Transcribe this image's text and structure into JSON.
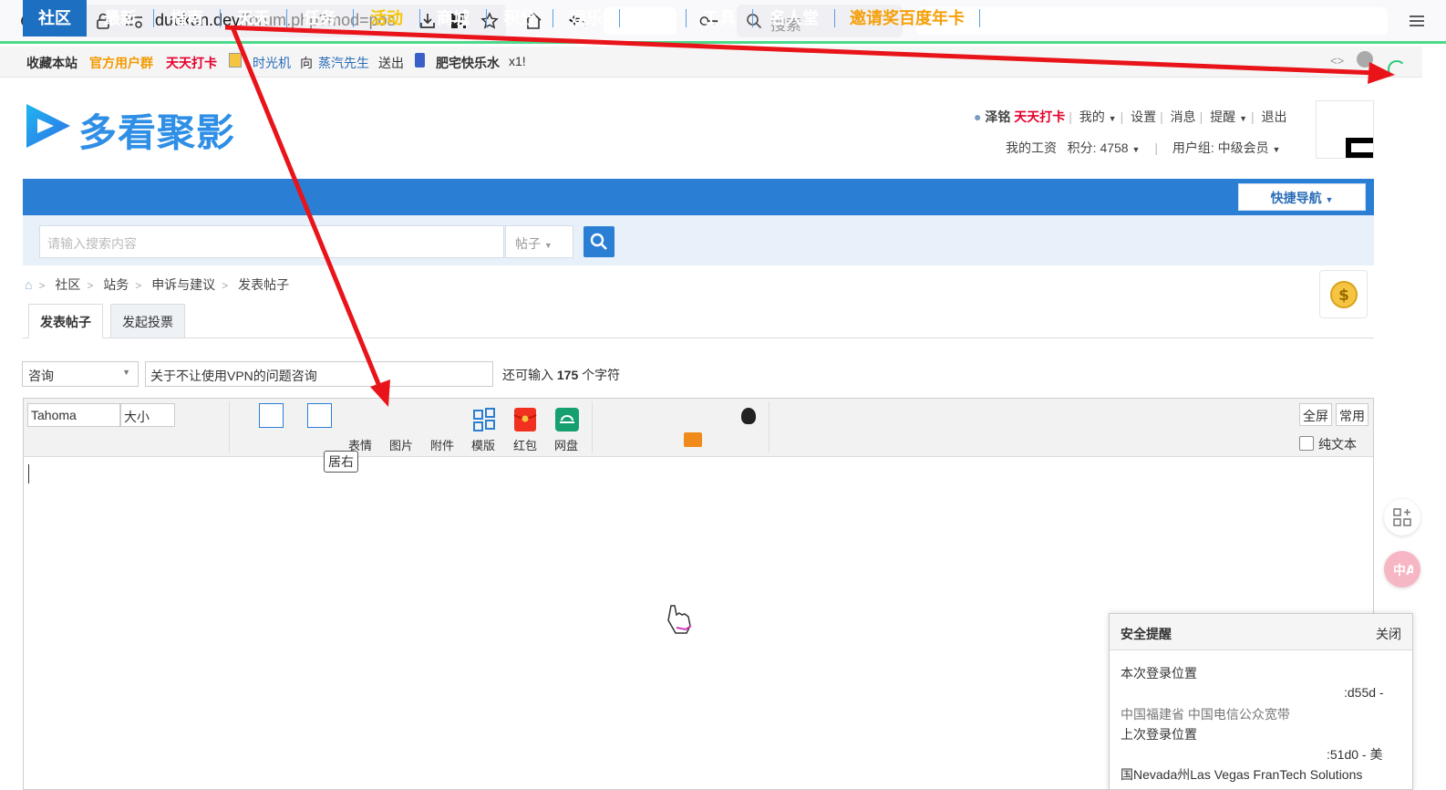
{
  "browser": {
    "url_main": "duokan.dev",
    "url_rest": "/forum.php?mod=pos",
    "search_placeholder": "搜索"
  },
  "topstrip": {
    "items": [
      "收藏本站",
      "官方用户群",
      "天天打卡",
      "时光机",
      "向",
      "蒸汽先生",
      "送出",
      "肥宅快乐水",
      "x1!"
    ]
  },
  "header": {
    "logo_text": "多看聚影",
    "username": "泽铭",
    "daily_checkin": "天天打卡",
    "my": "我的",
    "settings": "设置",
    "messages": "消息",
    "reminders": "提醒",
    "logout": "退出",
    "salary": "我的工资",
    "points": "积分: 4758",
    "usergroup": "用户组: 中级会员"
  },
  "nav": {
    "items": [
      "社区",
      "最新",
      "指南",
      "天天",
      "任务",
      "活动",
      "商城",
      "积分",
      "娱乐",
      "回家",
      "工具",
      "名人堂",
      "邀请奖百度年卡"
    ],
    "quick_nav": "快捷导航"
  },
  "site_search": {
    "placeholder": "请输入搜索内容",
    "type": "帖子"
  },
  "breadcrumb": [
    "社区",
    "站务",
    "申诉与建议",
    "发表帖子"
  ],
  "tabs": [
    "发表帖子",
    "发起投票"
  ],
  "post": {
    "category": "咨询",
    "subject": "关于不让使用VPN的问题咨询",
    "remain_prefix": "还可输入",
    "remain_count": "175",
    "remain_suffix": "个字符"
  },
  "editor": {
    "font": "Tahoma",
    "size": "大小",
    "tools": [
      "表情",
      "图片",
      "附件",
      "模版",
      "红包",
      "网盘"
    ],
    "tooltip": "居右",
    "fullscreen": "全屏",
    "common": "常用",
    "plain_text": "纯文本"
  },
  "security": {
    "title": "安全提醒",
    "close": "关闭",
    "this_login": "本次登录位置",
    "this_ip": ":d55d -",
    "this_loc": "中国福建省 中国电信公众宽带",
    "last_login": "上次登录位置",
    "last_ip": ":51d0 - 美",
    "last_loc": "国Nevada州Las Vegas FranTech Solutions"
  },
  "colors": {
    "nav_blue": "#2a7fd4",
    "highlight_red": "#e4002b",
    "highlight_orange": "#f39a00",
    "annotation_red": "#e8141a"
  }
}
